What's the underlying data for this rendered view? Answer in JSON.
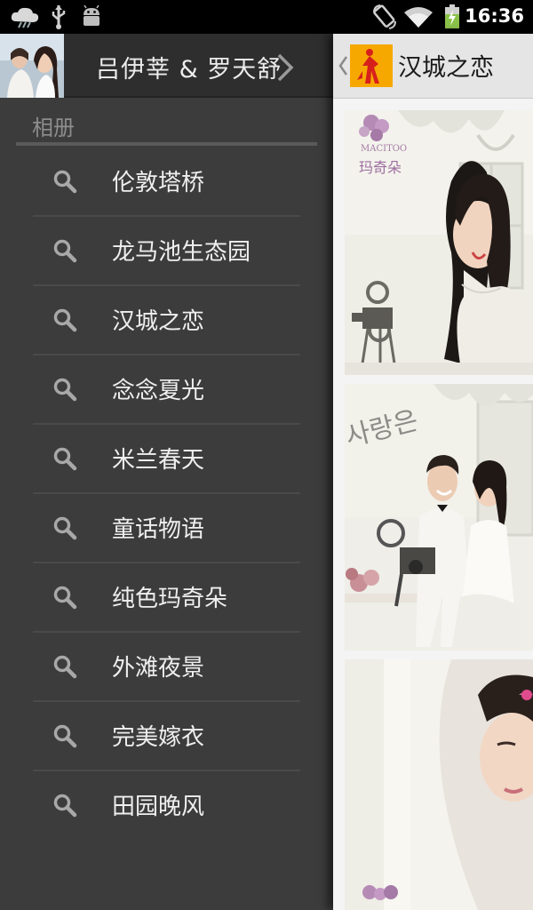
{
  "status_bar": {
    "time": "16:36",
    "icons": [
      "weather-cloud-icon",
      "usb-icon",
      "android-debug-icon",
      "rotation-lock-icon",
      "wifi-icon",
      "battery-charging-icon"
    ]
  },
  "drawer": {
    "profile_name": "吕伊莘 & 罗天舒",
    "section_title": "相册",
    "items": [
      {
        "label": "伦敦塔桥",
        "icon": "search-icon"
      },
      {
        "label": "龙马池生态园",
        "icon": "search-icon"
      },
      {
        "label": "汉城之恋",
        "icon": "search-icon"
      },
      {
        "label": "念念夏光",
        "icon": "search-icon"
      },
      {
        "label": "米兰春天",
        "icon": "search-icon"
      },
      {
        "label": "童话物语",
        "icon": "search-icon"
      },
      {
        "label": "纯色玛奇朵",
        "icon": "search-icon"
      },
      {
        "label": "外滩夜景",
        "icon": "search-icon"
      },
      {
        "label": "完美嫁衣",
        "icon": "search-icon"
      },
      {
        "label": "田园晚风",
        "icon": "search-icon"
      }
    ]
  },
  "content": {
    "title": "汉城之恋",
    "photos": [
      {
        "watermark_brand": "MACITOO",
        "watermark_cn": "玛奇朵"
      },
      {
        "overlay_text": "사랑은"
      },
      {}
    ]
  },
  "colors": {
    "drawer_bg": "#3c3c3c",
    "header_bg": "#2e2e2e",
    "actionbar_bg": "#e5e5e5",
    "app_icon_bg": "#f7a800"
  }
}
